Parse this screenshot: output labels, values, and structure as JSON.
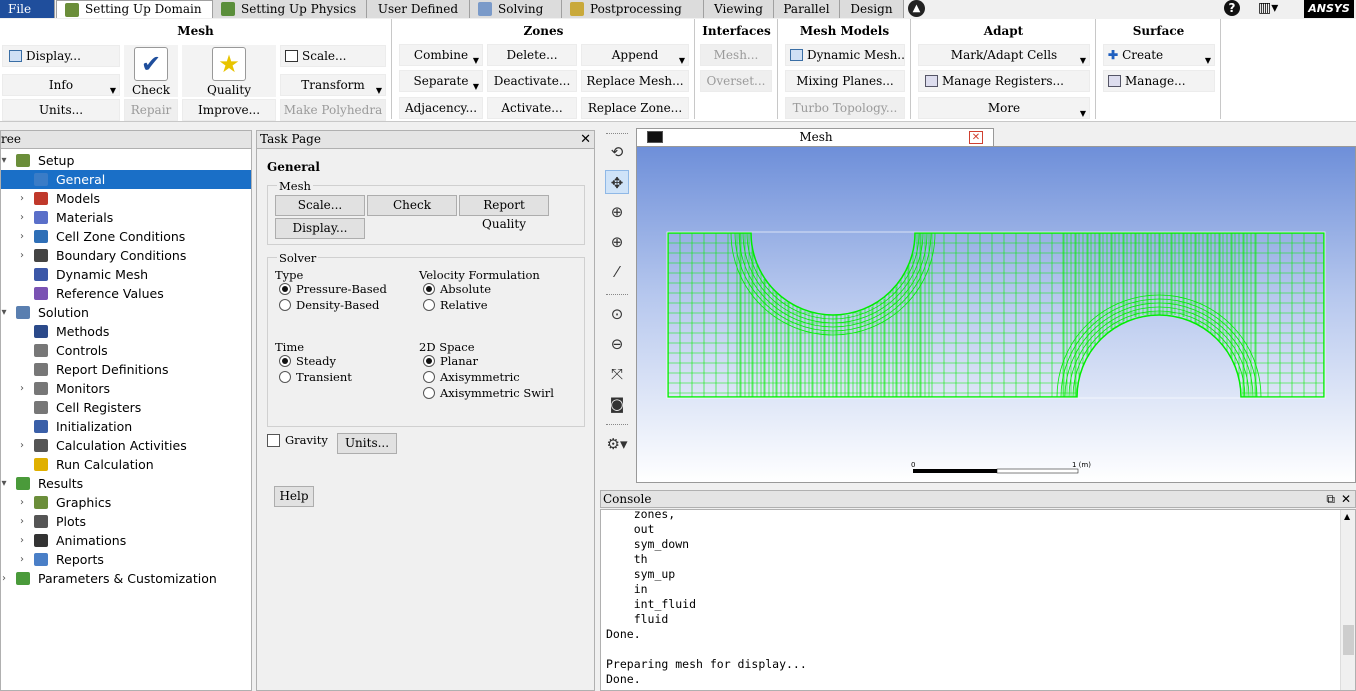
{
  "menubar": {
    "file": "File",
    "tabs": [
      "Setting Up Domain",
      "Setting Up Physics",
      "User Defined",
      "Solving",
      "Postprocessing",
      "Viewing",
      "Parallel",
      "Design"
    ],
    "brand": "ANSYS",
    "help": "?"
  },
  "ribbon": {
    "mesh": {
      "title": "Mesh",
      "display": "Display...",
      "info": "Info",
      "units": "Units...",
      "check": "Check",
      "repair": "Repair",
      "quality": "Quality",
      "improve": "Improve...",
      "scale": "Scale...",
      "transform": "Transform",
      "make_polyhedra": "Make Polyhedra"
    },
    "zones": {
      "title": "Zones",
      "combine": "Combine",
      "separate": "Separate",
      "adjacency": "Adjacency...",
      "delete": "Delete...",
      "deactivate": "Deactivate...",
      "activate": "Activate...",
      "append": "Append",
      "replace_mesh": "Replace Mesh...",
      "replace_zone": "Replace Zone..."
    },
    "interfaces": {
      "title": "Interfaces",
      "mesh": "Mesh...",
      "overset": "Overset..."
    },
    "mesh_models": {
      "title": "Mesh Models",
      "dynamic_mesh": "Dynamic Mesh...",
      "mixing_planes": "Mixing Planes...",
      "turbo_topology": "Turbo Topology..."
    },
    "adapt": {
      "title": "Adapt",
      "mark_adapt": "Mark/Adapt Cells",
      "manage_registers": "Manage Registers...",
      "more": "More"
    },
    "surface": {
      "title": "Surface",
      "create": "Create",
      "manage": "Manage..."
    }
  },
  "tree": {
    "header": "ree",
    "rows": [
      {
        "label": "Setup",
        "level": 0,
        "toggle": "▾",
        "color": "#6b8e3a"
      },
      {
        "label": "General",
        "level": 1,
        "toggle": "",
        "color": "#3a7cc7",
        "selected": true
      },
      {
        "label": "Models",
        "level": 1,
        "toggle": "›",
        "color": "#c0392b"
      },
      {
        "label": "Materials",
        "level": 1,
        "toggle": "›",
        "color": "#5a6fc9"
      },
      {
        "label": "Cell Zone Conditions",
        "level": 1,
        "toggle": "›",
        "color": "#2f6fb7"
      },
      {
        "label": "Boundary Conditions",
        "level": 1,
        "toggle": "›",
        "color": "#444"
      },
      {
        "label": "Dynamic Mesh",
        "level": 1,
        "toggle": "",
        "color": "#3b57a8"
      },
      {
        "label": "Reference Values",
        "level": 1,
        "toggle": "",
        "color": "#7a52b3"
      },
      {
        "label": "Solution",
        "level": 0,
        "toggle": "▾",
        "color": "#5a7fb0"
      },
      {
        "label": "Methods",
        "level": 1,
        "toggle": "",
        "color": "#2b4a8a"
      },
      {
        "label": "Controls",
        "level": 1,
        "toggle": "",
        "color": "#777"
      },
      {
        "label": "Report Definitions",
        "level": 1,
        "toggle": "",
        "color": "#777"
      },
      {
        "label": "Monitors",
        "level": 1,
        "toggle": "›",
        "color": "#777"
      },
      {
        "label": "Cell Registers",
        "level": 1,
        "toggle": "",
        "color": "#777"
      },
      {
        "label": "Initialization",
        "level": 1,
        "toggle": "",
        "color": "#3a5fa8"
      },
      {
        "label": "Calculation Activities",
        "level": 1,
        "toggle": "›",
        "color": "#555"
      },
      {
        "label": "Run Calculation",
        "level": 1,
        "toggle": "",
        "color": "#e0b000"
      },
      {
        "label": "Results",
        "level": 0,
        "toggle": "▾",
        "color": "#4a9a3a"
      },
      {
        "label": "Graphics",
        "level": 1,
        "toggle": "›",
        "color": "#6b8e3a"
      },
      {
        "label": "Plots",
        "level": 1,
        "toggle": "›",
        "color": "#555"
      },
      {
        "label": "Animations",
        "level": 1,
        "toggle": "›",
        "color": "#333"
      },
      {
        "label": "Reports",
        "level": 1,
        "toggle": "›",
        "color": "#4a7fc7"
      },
      {
        "label": "Parameters & Customization",
        "level": 0,
        "toggle": "›",
        "color": "#4a9a3a"
      }
    ]
  },
  "task": {
    "header": "Task Page",
    "title": "General",
    "mesh_group": "Mesh",
    "scale": "Scale...",
    "check": "Check",
    "report_quality": "Report Quality",
    "display": "Display...",
    "solver_group": "Solver",
    "type_label": "Type",
    "type_options": [
      "Pressure-Based",
      "Density-Based"
    ],
    "velocity_label": "Velocity Formulation",
    "velocity_options": [
      "Absolute",
      "Relative"
    ],
    "time_label": "Time",
    "time_options": [
      "Steady",
      "Transient"
    ],
    "space_label": "2D Space",
    "space_options": [
      "Planar",
      "Axisymmetric",
      "Axisymmetric Swirl"
    ],
    "gravity": "Gravity",
    "units": "Units...",
    "help": "Help"
  },
  "graphics": {
    "tab_title": "Mesh",
    "scale_left": "0",
    "scale_right": "1 (m)",
    "mesh_color": "#00ee00"
  },
  "console": {
    "header": "Console",
    "lines": [
      "    zones,",
      "    out",
      "    sym_down",
      "    th",
      "    sym_up",
      "    in",
      "    int_fluid",
      "    fluid",
      "Done.",
      "",
      "Preparing mesh for display...",
      "Done."
    ]
  },
  "colors": {
    "accent": "#1a6fc7",
    "file_tab": "#1f4e9c"
  }
}
